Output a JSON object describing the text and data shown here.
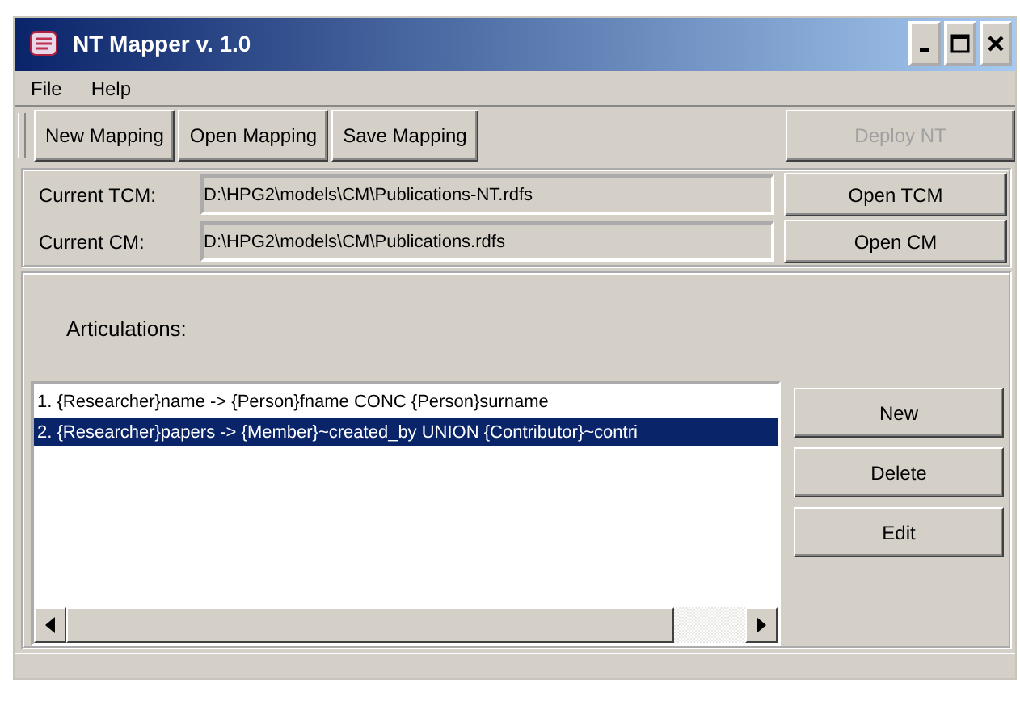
{
  "window": {
    "title": "NT Mapper v. 1.0"
  },
  "menu": [
    "File",
    "Help"
  ],
  "toolbar": [
    {
      "label": "New Mapping",
      "disabled": false
    },
    {
      "label": "Open Mapping",
      "disabled": false
    },
    {
      "label": "Save Mapping",
      "disabled": false
    }
  ],
  "deploy_button": {
    "label": "Deploy NT",
    "disabled": true
  },
  "models": [
    {
      "label": "Current TCM:",
      "value": "D:\\HPG2\\models\\CM\\Publications-NT.rdfs",
      "button": "Open TCM"
    },
    {
      "label": "Current CM:",
      "value": "D:\\HPG2\\models\\CM\\Publications.rdfs",
      "button": "Open CM"
    }
  ],
  "articulations": {
    "label": "Articulations:",
    "items": [
      {
        "text": "1. {Researcher}name ->  {Person}fname CONC {Person}surname",
        "selected": false
      },
      {
        "text": "2. {Researcher}papers ->  {Member}~created_by UNION {Contributor}~contri",
        "selected": true
      }
    ],
    "buttons": [
      "New",
      "Delete",
      "Edit"
    ]
  }
}
